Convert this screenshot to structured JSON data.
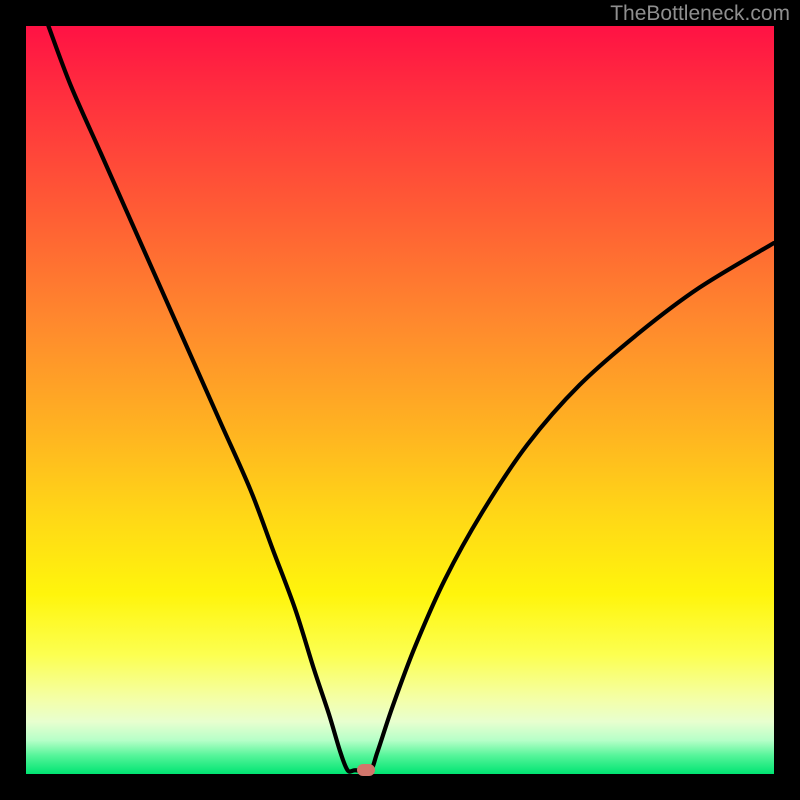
{
  "watermark": "TheBottleneck.com",
  "colors": {
    "frame": "#000000",
    "curve": "#000000",
    "marker": "#d1756b",
    "gradient_top": "#ff1244",
    "gradient_bottom": "#00e472"
  },
  "chart_data": {
    "type": "line",
    "title": "",
    "xlabel": "",
    "ylabel": "",
    "xlim": [
      0,
      100
    ],
    "ylim": [
      0,
      100
    ],
    "series": [
      {
        "name": "bottleneck-curve",
        "x": [
          3,
          6,
          10,
          14,
          18,
          22,
          26,
          30,
          33,
          36,
          38.5,
          40.5,
          42,
          43,
          44,
          46,
          47,
          49,
          52,
          56,
          61,
          67,
          74,
          82,
          90,
          100
        ],
        "y": [
          100,
          92,
          83,
          74,
          65,
          56,
          47,
          38,
          30,
          22,
          14,
          8,
          3,
          0.5,
          0.5,
          0.5,
          3,
          9,
          17,
          26,
          35,
          44,
          52,
          59,
          65,
          71
        ]
      }
    ],
    "annotations": [
      {
        "name": "optimal-marker",
        "x": 45.5,
        "y": 0.5
      }
    ],
    "grid": false,
    "legend": false
  }
}
